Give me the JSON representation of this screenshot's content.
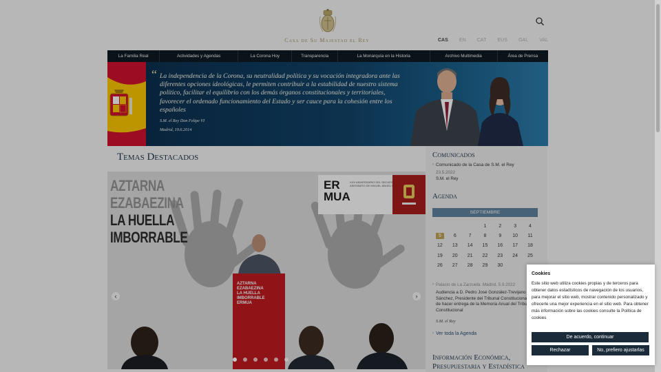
{
  "header": {
    "site_title": "Casa de Su Majestad el Rey",
    "languages": [
      {
        "code": "CAS",
        "active": true
      },
      {
        "code": "EN",
        "active": false
      },
      {
        "code": "CAT",
        "active": false
      },
      {
        "code": "EUS",
        "active": false
      },
      {
        "code": "GAL",
        "active": false
      },
      {
        "code": "VAL",
        "active": false
      }
    ],
    "search_icon": "search-icon",
    "crest_icon": "royal-crest-icon"
  },
  "nav": {
    "items": [
      "La Familia Real",
      "Actividades y Agendas",
      "La Corona Hoy",
      "Transparencia",
      "La Monarquía en la Historia",
      "Archivo Multimedia",
      "Área de Prensa"
    ]
  },
  "banner": {
    "quote": "La independencia de la Corona, su neutralidad política y su vocación integradora ante las diferentes opciones ideológicas, le permiten contribuir a la estabilidad de nuestro sistema político, facilitar el equilibrio con los demás órganos constitucionales y territoriales, favorecer el ordenado funcionamiento del Estado y ser cauce para la cohesión entre los españoles",
    "author": "S.M. el Rey Don Felipe VI",
    "date": "Madrid, 19.6.2014"
  },
  "featured": {
    "title": "Temas Destacados",
    "slide_lines": [
      "AZTARNA",
      "EZABAEZINA",
      "LA HUELLA",
      "IMBORRABLE"
    ],
    "ermua_word": [
      "ER",
      "MUA"
    ],
    "ermua_sub": "XXV ANIVERSARIO DEL SECUESTRO Y ASESINATO DE MIGUEL ÁNGEL BLANCO",
    "podium_lines": [
      "AZTARNA",
      "EZABAEZINA",
      "LA HUELLA",
      "IMBORRABLE",
      "ERMUA"
    ],
    "arrow_prev": "‹",
    "arrow_next": "›"
  },
  "communications": {
    "title": "Comunicados",
    "item": "Comunicado de la Casa de S.M. el Rey",
    "date": "23.5.2022",
    "person": "S.M. el Rey"
  },
  "agenda": {
    "title": "Agenda",
    "month": "SEPTIEMBRE",
    "weeks": [
      [
        "",
        "",
        "",
        "1",
        "2",
        "3",
        "4"
      ],
      [
        "5",
        "6",
        "7",
        "8",
        "9",
        "10",
        "11"
      ],
      [
        "12",
        "13",
        "14",
        "15",
        "16",
        "17",
        "18"
      ],
      [
        "19",
        "20",
        "21",
        "22",
        "23",
        "24",
        "25"
      ],
      [
        "26",
        "27",
        "28",
        "29",
        "30",
        "",
        ""
      ]
    ],
    "highlight_day": "5",
    "event_place": "Palacio de La Zarzuela. Madrid, 5.9.2022",
    "event_desc": "Audiencia a D. Pedro José González-Trevijano Sánchez, Presidente del Tribunal Constitucional, a fin de hacer entrega de la Memoria Anual del Tribunal Constitucional",
    "event_person": "S.M. el Rey",
    "view_all": "Ver toda la Agenda"
  },
  "economic_info": {
    "title": "Información Económica, Presupuestaria y Estadística"
  },
  "cookies": {
    "title": "Cookies",
    "text": "Este sitio web utiliza cookies propias y de terceros para obtener datos estadísticos de navegación de los usuarios, para mejorar el sitio web, mostrar contenido personalizado y ofrecerle una mejor experiencia en el sitio web. Para obtener más información sobre las cookies consulte la Política de cookies",
    "accept": "De acuerdo, continuar",
    "reject": "Rechazar",
    "adjust": "No, prefiero ajustarlas"
  },
  "colors": {
    "nav_bg": "#0f1922",
    "accent_gold": "#b79e55",
    "calendar_header": "#5b7d98",
    "button_dark": "#1b2b3a"
  }
}
